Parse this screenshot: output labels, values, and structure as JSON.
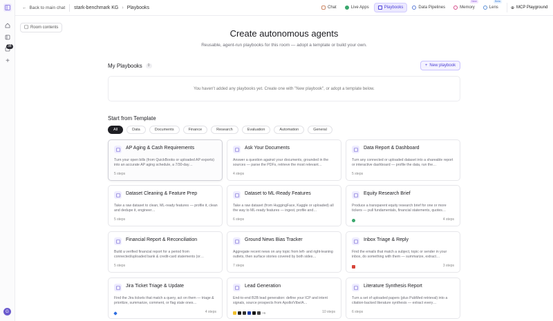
{
  "nav": {
    "back_label": "Back to main chat",
    "kg_name": "stark-benchmark KG",
    "current": "Playbooks",
    "tabs": [
      {
        "label": "Chat",
        "tag": ""
      },
      {
        "label": "Live Apps",
        "tag": ""
      },
      {
        "label": "Playbooks",
        "tag": ""
      },
      {
        "label": "Data Pipelines",
        "tag": ""
      },
      {
        "label": "Memory",
        "tag": "New"
      },
      {
        "label": "Lens",
        "tag": "Beta"
      }
    ],
    "mcp_label": "MCP Playground"
  },
  "rail": {
    "badge": "38",
    "user_initial": "G"
  },
  "room_contents_label": "Room contents",
  "hero": {
    "title": "Create autonomous agents",
    "subtitle": "Reusable, agent-run playbooks for this room — adopt a template or build your own."
  },
  "my_playbooks": {
    "heading": "My Playbooks",
    "count": "0",
    "new_button": "New playbook",
    "empty_text": "You haven't added any playbooks yet. Create one with \"New playbook\", or adopt a template below."
  },
  "templates": {
    "heading": "Start from Template",
    "filters": [
      "All",
      "Data",
      "Documents",
      "Finance",
      "Research",
      "Evaluation",
      "Automation",
      "General"
    ],
    "active_filter": "All",
    "cards": [
      {
        "title": "AP Aging & Cash Requirements",
        "desc": "Turn your open bills (from QuickBooks or uploaded AP exports) into an accurate AP aging schedule, a 7/30-day…",
        "steps": "5 steps"
      },
      {
        "title": "Ask Your Documents",
        "desc": "Answer a question against your documents, grounded in the sources — parse the PDFs, retrieve the most relevant…",
        "steps": "4 steps"
      },
      {
        "title": "Data Report & Dashboard",
        "desc": "Turn any connected or uploaded dataset into a shareable report or interactive dashboard — profile the data, run the…",
        "steps": "5 steps"
      },
      {
        "title": "Dataset Cleaning & Feature Prep",
        "desc": "Take a raw dataset to clean, ML-ready features — profile it, clean and dedupe it, engineer…",
        "steps": "5 steps"
      },
      {
        "title": "Dataset to ML-Ready Features",
        "desc": "Take a raw dataset (from HuggingFace, Kaggle or uploaded) all the way to ML-ready features — ingest, profile and…",
        "steps": "6 steps"
      },
      {
        "title": "Equity Research Brief",
        "desc": "Produce a transparent equity research brief for one or more tickers — pull fundamentals, financial statements, quotes…",
        "steps": "4 steps"
      },
      {
        "title": "Financial Report & Reconciliation",
        "desc": "Build a verified financial report for a period from connected/uploaded bank & credit-card statements (or…",
        "steps": "5 steps"
      },
      {
        "title": "Ground News Bias Tracker",
        "desc": "Aggregate recent news on any topic from left- and right-leaning outlets, then surface stories covered by both sides…",
        "steps": "7 steps"
      },
      {
        "title": "Inbox Triage & Reply",
        "desc": "Find the emails that match a subject, topic or sender in your inbox, do something with them — summarize, extract…",
        "steps": "3 steps"
      },
      {
        "title": "Jira Ticket Triage & Update",
        "desc": "Find the Jira tickets that match a query, act on them — triage & prioritize, summarize, comment, or flag stale ones…",
        "steps": "4 steps"
      },
      {
        "title": "Lead Generation",
        "desc": "End-to-end B2B lead generation: define your ICP and intent signals, source prospects from Apollo/Vibe/A…",
        "steps": "10 steps",
        "more": "+6"
      },
      {
        "title": "Literature Synthesis Report",
        "desc": "Turn a set of uploaded papers (plus PubMed retrieval) into a citation-backed literature synthesis — extract every…",
        "steps": "6 steps"
      }
    ]
  },
  "colors": {
    "accent": "#4b3fd6",
    "accent_bg": "#ece9ff"
  }
}
